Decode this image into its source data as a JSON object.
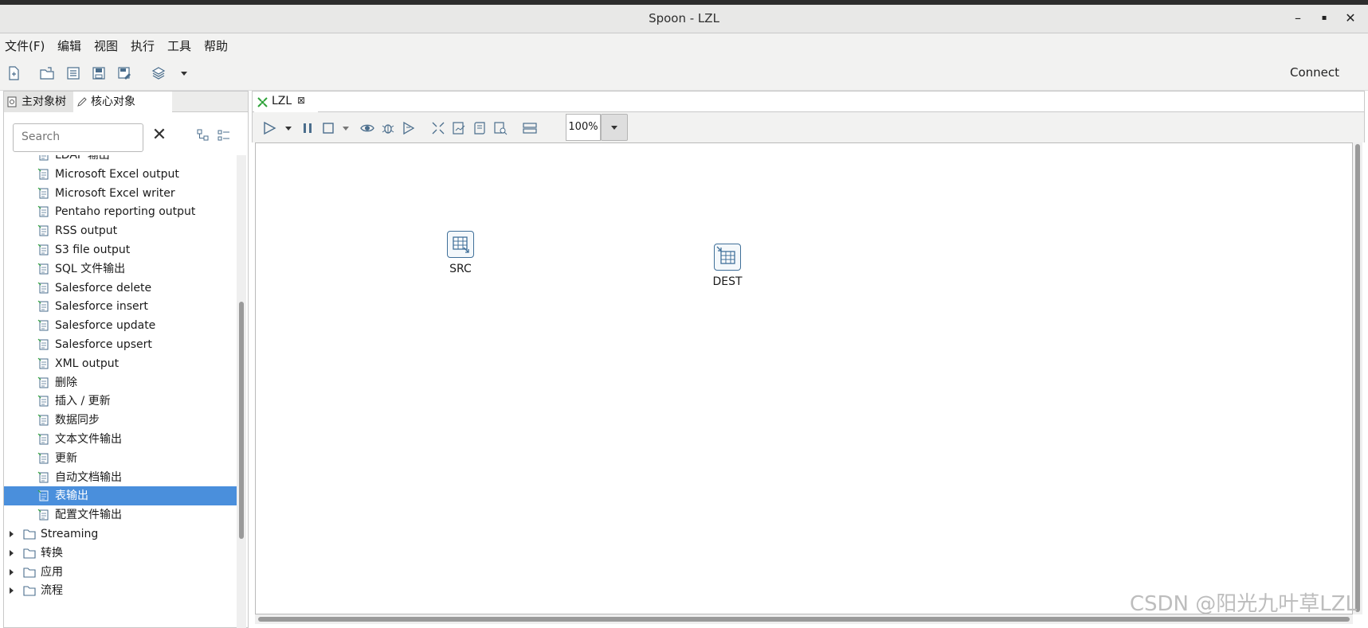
{
  "window": {
    "title": "Spoon - LZL",
    "controls": [
      "–",
      "▪",
      "✕"
    ]
  },
  "menu": [
    "文件(F)",
    "编辑",
    "视图",
    "执行",
    "工具",
    "帮助"
  ],
  "toolbar": {
    "connect_label": "Connect"
  },
  "left_panel": {
    "tabs": [
      "主对象树",
      "核心对象"
    ],
    "search_placeholder": "Search",
    "tree_items": [
      {
        "label": "LDAP 输出",
        "icon": "ldap-icon"
      },
      {
        "label": "Microsoft Excel output",
        "icon": "excel-icon"
      },
      {
        "label": "Microsoft Excel writer",
        "icon": "excel-icon"
      },
      {
        "label": "Pentaho reporting output",
        "icon": "report-icon"
      },
      {
        "label": "RSS output",
        "icon": "rss-icon"
      },
      {
        "label": "S3 file output",
        "icon": "s3-icon"
      },
      {
        "label": "SQL 文件输出",
        "icon": "sql-file-icon"
      },
      {
        "label": "Salesforce delete",
        "icon": "salesforce-icon"
      },
      {
        "label": "Salesforce insert",
        "icon": "salesforce-icon"
      },
      {
        "label": "Salesforce update",
        "icon": "salesforce-icon"
      },
      {
        "label": "Salesforce upsert",
        "icon": "salesforce-icon"
      },
      {
        "label": "XML output",
        "icon": "xml-icon"
      },
      {
        "label": "删除",
        "icon": "delete-icon"
      },
      {
        "label": "插入 / 更新",
        "icon": "insert-update-icon"
      },
      {
        "label": "数据同步",
        "icon": "sync-icon"
      },
      {
        "label": "文本文件输出",
        "icon": "text-file-icon"
      },
      {
        "label": "更新",
        "icon": "refresh-icon"
      },
      {
        "label": "自动文档输出",
        "icon": "doc-icon"
      },
      {
        "label": "表输出",
        "icon": "table-output-icon",
        "selected": true
      },
      {
        "label": "配置文件输出",
        "icon": "config-file-icon"
      }
    ],
    "folders": [
      "Streaming",
      "转换",
      "应用",
      "流程"
    ]
  },
  "editor": {
    "tab_label": "LZL",
    "zoom": "100%",
    "steps": [
      {
        "label": "SRC"
      },
      {
        "label": "DEST"
      }
    ]
  },
  "watermark": "CSDN @阳光九叶草LZL"
}
